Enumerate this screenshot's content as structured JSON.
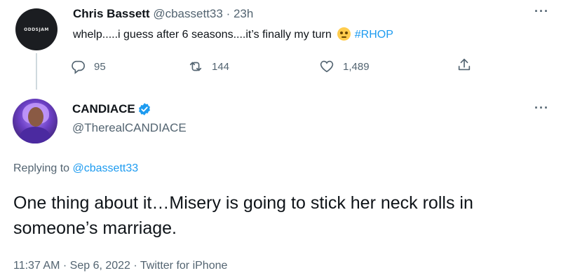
{
  "parent_tweet": {
    "avatar_logo": "ODDSJAM",
    "name": "Chris Bassett",
    "handle": "@cbassett33",
    "separator": "·",
    "time": "23h",
    "text_before_emoji": "whelp.....i guess after 6 seasons....it’s finally my turn",
    "emoji": "face-with-rolling-eyes",
    "hashtag": "#RHOP",
    "reply_count": "95",
    "retweet_count": "144",
    "like_count": "1,489",
    "more_label": "···"
  },
  "main_tweet": {
    "name": "CANDIACE",
    "handle": "@TherealCANDIACE",
    "verified": true,
    "replying_prefix": "Replying to",
    "replying_to": "@cbassett33",
    "text": "One thing about it…Misery is going to stick her neck rolls in someone’s marriage.",
    "time": "11:37 AM",
    "sep1": "·",
    "date": "Sep 6, 2022",
    "sep2": "·",
    "source": "Twitter for iPhone",
    "more_label": "···"
  },
  "colors": {
    "accent": "#1d9bf0",
    "secondary_text": "#536471",
    "primary_text": "#0f1419",
    "thread_line": "#cfd9de"
  },
  "icons": {
    "reply": "reply-icon",
    "retweet": "retweet-icon",
    "like": "heart-icon",
    "share": "share-icon",
    "verified": "verified-badge-icon",
    "more": "more-icon"
  }
}
